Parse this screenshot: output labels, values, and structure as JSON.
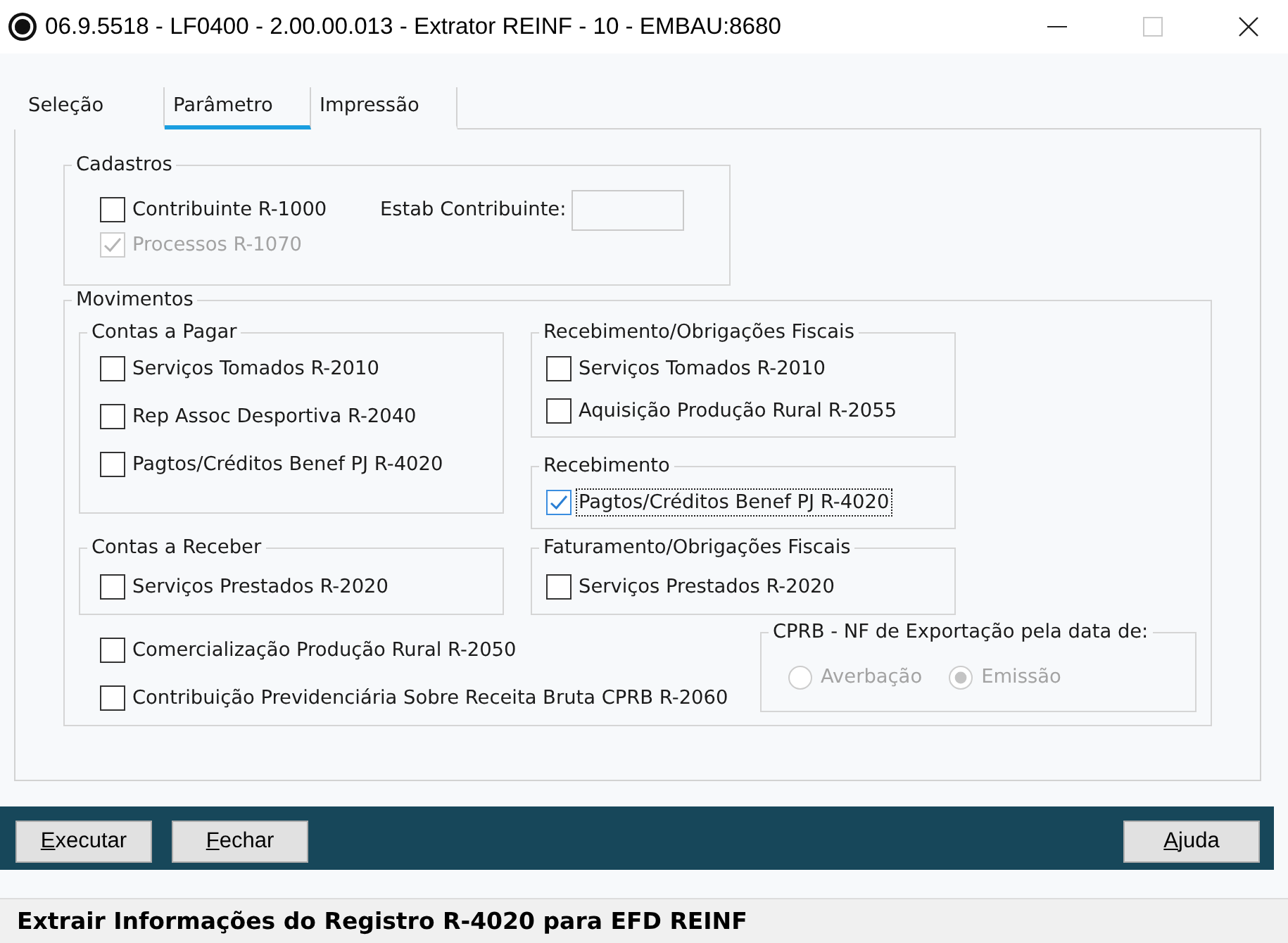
{
  "window": {
    "title": "06.9.5518 - LF0400 - 2.00.00.013 - Extrator REINF - 10 - EMBAU:8680",
    "controls": [
      {
        "kind": "minimize",
        "disabled": false
      },
      {
        "kind": "maximize",
        "disabled": true
      },
      {
        "kind": "close",
        "disabled": false
      }
    ]
  },
  "tabs": [
    {
      "label": "Seleção",
      "selected": false
    },
    {
      "label": "Parâmetro",
      "selected": true
    },
    {
      "label": "Impressão",
      "selected": false
    }
  ],
  "cadastros": {
    "title": "Cadastros",
    "checkboxes": [
      {
        "label": "Contribuinte R-1000",
        "checked": false,
        "disabled": false,
        "focused": false
      },
      {
        "label": "Processos R-1070",
        "checked": true,
        "disabled": true,
        "focused": false
      }
    ],
    "estab_field": {
      "label": "Estab Contribuinte:"
    }
  },
  "movimentos": {
    "title": "Movimentos",
    "rows": [
      {
        "left": [
          {
            "title": "Contas a Pagar",
            "checkboxes": [
              {
                "label": "Serviços Tomados R-2010",
                "checked": false,
                "disabled": false,
                "focused": false
              },
              {
                "label": "Rep Assoc Desportiva R-2040",
                "checked": false,
                "disabled": false,
                "focused": false
              },
              {
                "label": "Pagtos/Créditos Benef PJ R-4020",
                "checked": false,
                "disabled": false,
                "focused": false
              }
            ]
          }
        ],
        "right": [
          {
            "title": "Recebimento/Obrigações Fiscais",
            "checkboxes": [
              {
                "label": "Serviços Tomados R-2010",
                "checked": false,
                "disabled": false,
                "focused": false
              },
              {
                "label": "Aquisição Produção Rural R-2055",
                "checked": false,
                "disabled": false,
                "focused": false
              }
            ]
          },
          {
            "title": "Recebimento",
            "checkboxes": [
              {
                "label": "Pagtos/Créditos Benef PJ R-4020",
                "checked": true,
                "disabled": false,
                "focused": true
              }
            ]
          }
        ]
      },
      {
        "left": [
          {
            "title": "Contas a Receber",
            "checkboxes": [
              {
                "label": "Serviços Prestados R-2020",
                "checked": false,
                "disabled": false,
                "focused": false
              }
            ]
          }
        ],
        "right": [
          {
            "title": "Faturamento/Obrigações Fiscais",
            "checkboxes": [
              {
                "label": "Serviços Prestados R-2020",
                "checked": false,
                "disabled": false,
                "focused": false
              }
            ]
          }
        ]
      }
    ],
    "checkboxes": [
      {
        "label": "Comercialização Produção Rural R-2050",
        "checked": false,
        "disabled": false,
        "focused": false
      },
      {
        "label": "Contribuição Previdenciária Sobre Receita Bruta CPRB R-2060",
        "checked": false,
        "disabled": false,
        "focused": false
      }
    ],
    "cprb": {
      "title": "CPRB - NF de Exportação pela data de:",
      "radios": [
        {
          "label": "Averbação",
          "selected": false,
          "disabled": true
        },
        {
          "label": "Emissão",
          "selected": true,
          "disabled": true
        }
      ]
    }
  },
  "button_bar": {
    "left": [
      {
        "label": "Executar",
        "underlined_access_key": true
      },
      {
        "label": "Fechar",
        "underlined_access_key": true
      }
    ],
    "right": [
      {
        "label": "Ajuda",
        "underlined_access_key": true
      }
    ]
  },
  "status_bar": {
    "text": "Extrair Informações do Registro R-4020 para EFD REINF"
  }
}
